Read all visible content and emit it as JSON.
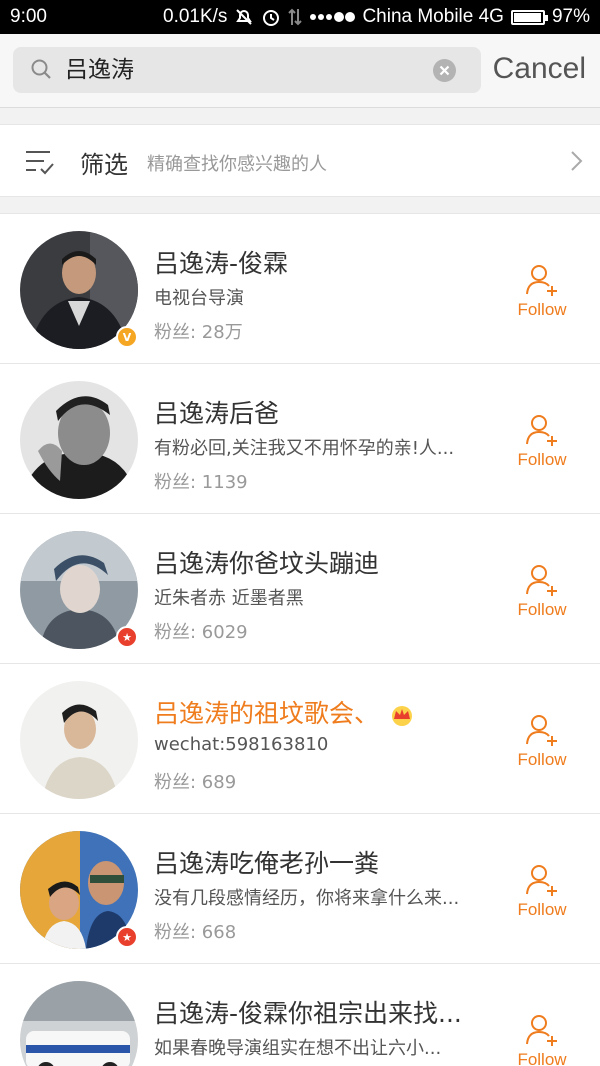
{
  "status_bar": {
    "time": "9:00",
    "speed": "0.01K/s",
    "carrier": "China Mobile 4G",
    "battery": "97%",
    "battery_level": 0.97
  },
  "search": {
    "query": "吕逸涛",
    "cancel_label": "Cancel"
  },
  "filter": {
    "title": "筛选",
    "subtitle": "精确查找你感兴趣的人"
  },
  "accent_color": "#ef7c1d",
  "users": [
    {
      "name": "吕逸涛-俊霖",
      "bio": "电视台导演",
      "fans": "粉丝: 28万",
      "badge": "V",
      "follow_label": "Follow"
    },
    {
      "name": "吕逸涛后爸",
      "bio": "有粉必回,关注我又不用怀孕的亲!人...",
      "fans": "粉丝: 1139",
      "badge": "",
      "follow_label": "Follow"
    },
    {
      "name": "吕逸涛你爸坟头蹦迪",
      "bio": "近朱者赤 近墨者黑",
      "fans": "粉丝: 6029",
      "badge": "★",
      "follow_label": "Follow"
    },
    {
      "name": "吕逸涛的祖坟歌会、",
      "bio": "wechat:598163810",
      "fans": "粉丝: 689",
      "badge": "",
      "follow_label": "Follow"
    },
    {
      "name": "吕逸涛吃俺老孙一粪",
      "bio": "没有几段感情经历，你将来拿什么来...",
      "fans": "粉丝: 668",
      "badge": "★",
      "follow_label": "Follow"
    },
    {
      "name": "吕逸涛-俊霖你祖宗出来找...",
      "bio": "如果春晚导演组实在想不出让六小...",
      "fans": "",
      "badge": "",
      "follow_label": "Follow"
    }
  ]
}
